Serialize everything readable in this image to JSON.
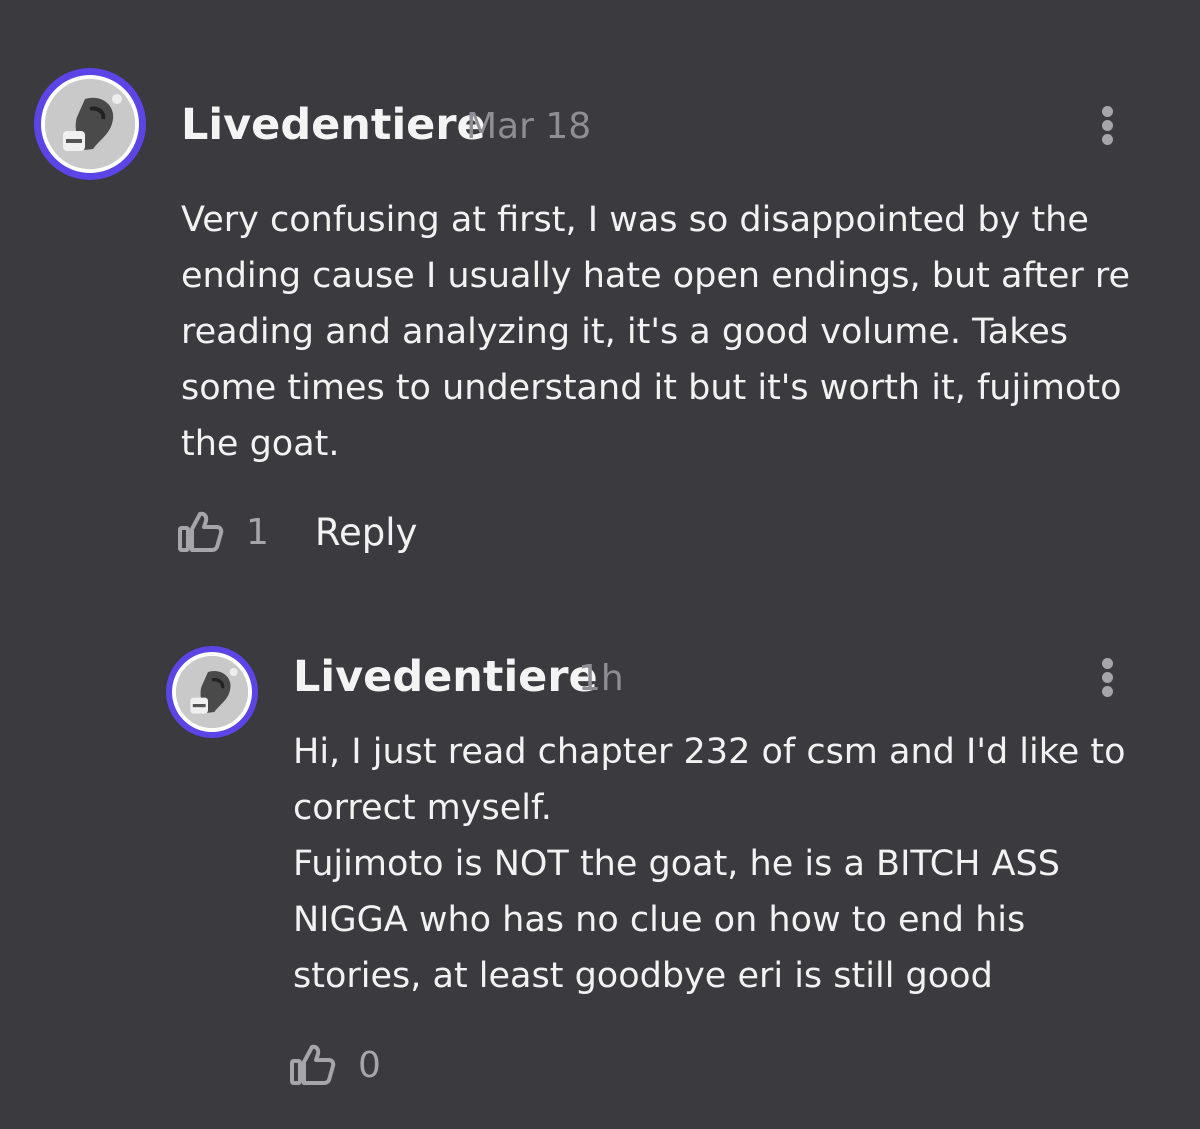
{
  "comments": [
    {
      "username": "Livedentiere",
      "timestamp": "Mar 18",
      "body": "Very confusing at first, I was so disappointed by the\nending cause I usually hate open endings, but after re\nreading and analyzing it, it's a good volume. Takes\nsome times to understand it but it's worth it, fujimoto\nthe goat.",
      "like_count": "1",
      "reply_label": "Reply",
      "icons": {
        "more": "more-vertical-icon",
        "like": "thumbs-up-icon"
      }
    },
    {
      "username": "Livedentiere",
      "timestamp": "1h",
      "body": "Hi, I just read chapter 232 of csm and I'd like to\ncorrect myself.\nFujimoto is NOT the goat, he is a BITCH ASS\nNIGGA who has no clue on how to end his\nstories, at least goodbye eri is still good",
      "like_count": "0",
      "icons": {
        "more": "more-vertical-icon",
        "like": "thumbs-up-icon"
      }
    }
  ],
  "colors": {
    "background": "#3a3a3f",
    "avatar_ring": "#5b45e6",
    "muted_text": "#8e8e94"
  }
}
